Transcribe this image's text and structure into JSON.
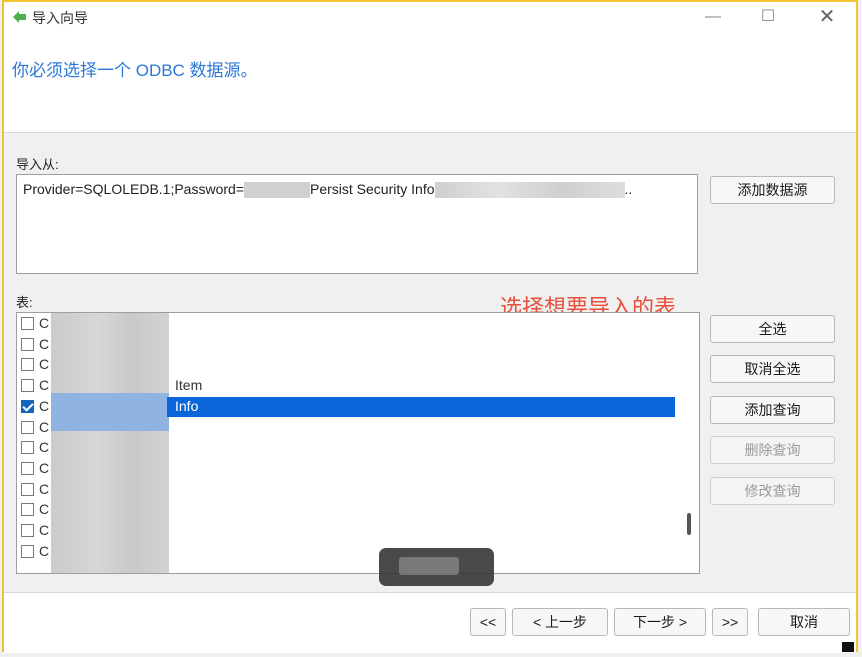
{
  "window": {
    "title": "导入向导",
    "minimize": "—",
    "maximize": "☐",
    "close": "✕"
  },
  "header": {
    "instruction": "你必须选择一个 ODBC 数据源。"
  },
  "import_from": {
    "label": "导入从:",
    "connection_prefix": "Provider=SQLOLEDB.1;Password=",
    "connection_mid": "Persist Security Info",
    "connection_suffix": ".."
  },
  "buttons": {
    "add_datasource": "添加数据源",
    "select_all": "全选",
    "deselect_all": "取消全选",
    "add_query": "添加查询",
    "delete_query": "删除查询",
    "modify_query": "修改查询"
  },
  "tables": {
    "label": "表:",
    "rows": [
      {
        "prefix": "C",
        "text": "",
        "checked": false
      },
      {
        "prefix": "C",
        "text": "",
        "checked": false
      },
      {
        "prefix": "C",
        "text": "",
        "checked": false
      },
      {
        "prefix": "C",
        "text": "Item",
        "checked": false
      },
      {
        "prefix": "C",
        "text": "Info",
        "checked": true
      },
      {
        "prefix": "C",
        "text": "",
        "checked": false
      },
      {
        "prefix": "C",
        "text": "",
        "checked": false
      },
      {
        "prefix": "C",
        "text": "",
        "checked": false
      },
      {
        "prefix": "C",
        "text": "",
        "checked": false
      },
      {
        "prefix": "C",
        "text": "",
        "checked": false
      },
      {
        "prefix": "C",
        "text": "",
        "checked": false
      },
      {
        "prefix": "C",
        "text": "",
        "checked": false
      }
    ]
  },
  "annotation": "选择想要导入的表",
  "nav": {
    "first": "<<",
    "prev": "< 上一步",
    "next": "下一步 >",
    "last": ">>",
    "cancel": "取消"
  }
}
